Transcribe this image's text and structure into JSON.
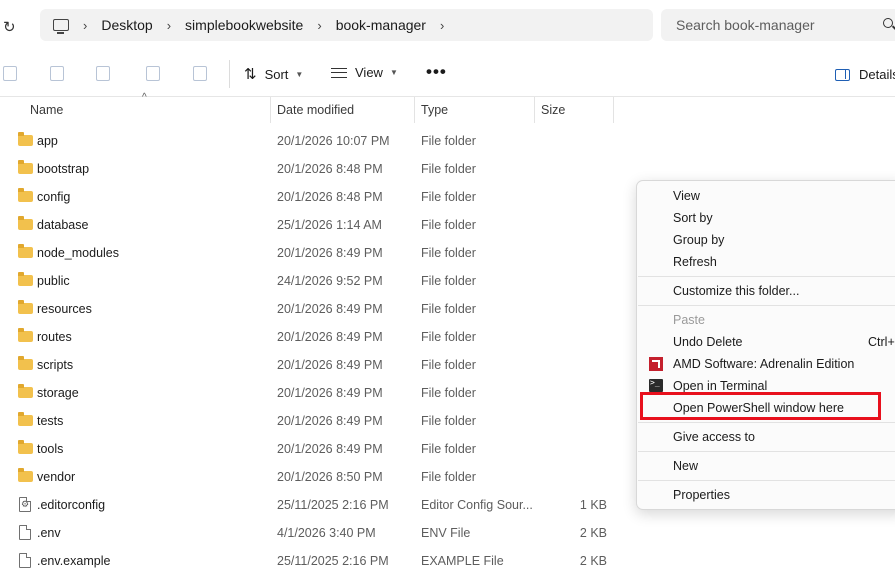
{
  "address": {
    "crumbs": [
      "Desktop",
      "simplebookwebsite",
      "book-manager"
    ]
  },
  "search": {
    "placeholder": "Search book-manager"
  },
  "toolbar": {
    "sort_label": "Sort",
    "view_label": "View",
    "details_label": "Details"
  },
  "columns": {
    "name": "Name",
    "date": "Date modified",
    "type": "Type",
    "size": "Size"
  },
  "files": [
    {
      "name": "app",
      "date": "20/1/2026 10:07 PM",
      "type": "File folder",
      "size": "",
      "kind": "folder"
    },
    {
      "name": "bootstrap",
      "date": "20/1/2026 8:48 PM",
      "type": "File folder",
      "size": "",
      "kind": "folder"
    },
    {
      "name": "config",
      "date": "20/1/2026 8:48 PM",
      "type": "File folder",
      "size": "",
      "kind": "folder"
    },
    {
      "name": "database",
      "date": "25/1/2026 1:14 AM",
      "type": "File folder",
      "size": "",
      "kind": "folder"
    },
    {
      "name": "node_modules",
      "date": "20/1/2026 8:49 PM",
      "type": "File folder",
      "size": "",
      "kind": "folder"
    },
    {
      "name": "public",
      "date": "24/1/2026 9:52 PM",
      "type": "File folder",
      "size": "",
      "kind": "folder"
    },
    {
      "name": "resources",
      "date": "20/1/2026 8:49 PM",
      "type": "File folder",
      "size": "",
      "kind": "folder"
    },
    {
      "name": "routes",
      "date": "20/1/2026 8:49 PM",
      "type": "File folder",
      "size": "",
      "kind": "folder"
    },
    {
      "name": "scripts",
      "date": "20/1/2026 8:49 PM",
      "type": "File folder",
      "size": "",
      "kind": "folder"
    },
    {
      "name": "storage",
      "date": "20/1/2026 8:49 PM",
      "type": "File folder",
      "size": "",
      "kind": "folder"
    },
    {
      "name": "tests",
      "date": "20/1/2026 8:49 PM",
      "type": "File folder",
      "size": "",
      "kind": "folder"
    },
    {
      "name": "tools",
      "date": "20/1/2026 8:49 PM",
      "type": "File folder",
      "size": "",
      "kind": "folder"
    },
    {
      "name": "vendor",
      "date": "20/1/2026 8:50 PM",
      "type": "File folder",
      "size": "",
      "kind": "folder"
    },
    {
      "name": ".editorconfig",
      "date": "25/11/2025 2:16 PM",
      "type": "Editor Config Sour...",
      "size": "1 KB",
      "kind": "config-file"
    },
    {
      "name": ".env",
      "date": "4/1/2026 3:40 PM",
      "type": "ENV File",
      "size": "2 KB",
      "kind": "file"
    },
    {
      "name": ".env.example",
      "date": "25/11/2025 2:16 PM",
      "type": "EXAMPLE File",
      "size": "2 KB",
      "kind": "file"
    }
  ],
  "context_menu": {
    "view": "View",
    "sort_by": "Sort by",
    "group_by": "Group by",
    "refresh": "Refresh",
    "customize": "Customize this folder...",
    "paste": "Paste",
    "undo_delete": "Undo Delete",
    "undo_shortcut": "Ctrl+",
    "amd": "AMD Software: Adrenalin Edition",
    "terminal": "Open in Terminal",
    "powershell": "Open PowerShell window here",
    "give_access": "Give access to",
    "new": "New",
    "properties": "Properties"
  },
  "colors": {
    "highlight": "#e8101d",
    "folder": "#f2c14d",
    "amd_brand": "#c4202d"
  }
}
